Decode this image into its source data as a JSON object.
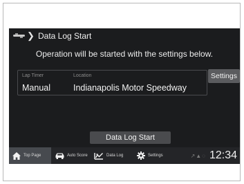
{
  "header": {
    "breadcrumb_icon": "chevron-right-icon",
    "title": "Data Log Start"
  },
  "message": "Operation will be started with the settings below.",
  "settings": {
    "lap_timer": {
      "label": "Lap Timer",
      "value": "Manual"
    },
    "location": {
      "label": "Location",
      "value": "Indianapolis Motor Speedway"
    },
    "button_label": "Settings"
  },
  "start_button_label": "Data Log Start",
  "nav": {
    "items": [
      {
        "label": "Top Page",
        "icon": "home-icon",
        "active": true
      },
      {
        "label": "Auto Score",
        "icon": "car-icon",
        "active": false
      },
      {
        "label": "Data Log",
        "icon": "data-log-icon",
        "active": false
      },
      {
        "label": "Settings",
        "icon": "gear-icon",
        "active": false
      }
    ]
  },
  "status": {
    "clock": "12:34"
  },
  "colors": {
    "screen_bg": "#1b1c1e",
    "nav_bg": "#242528",
    "nav_active_bg": "#474a4f",
    "button_bg": "#5b5c5f",
    "text": "#f2f2f2",
    "muted_text": "#8c8c8c"
  }
}
